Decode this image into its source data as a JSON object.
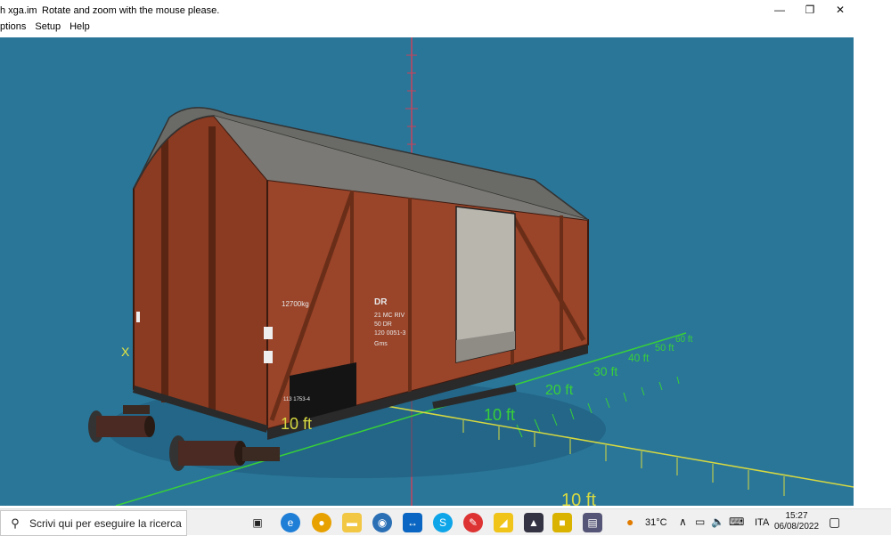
{
  "window": {
    "title": "h xga.im",
    "message": "Rotate and zoom with the mouse please.",
    "controls": {
      "minimize": "—",
      "restore": "❐",
      "close": "✕"
    }
  },
  "menu": [
    {
      "label": "ptions"
    },
    {
      "label": "Setup"
    },
    {
      "label": "Help"
    }
  ],
  "viewport": {
    "background": "#2a7699",
    "axis_label_x": "X",
    "grid_labels_right": [
      "10 ft",
      "20 ft",
      "30 ft",
      "40 ft",
      "50 ft",
      "60 ft"
    ],
    "grid_label_left": "10 ft",
    "grid_label_bottom": "10 ft",
    "wagon_markings": {
      "company": "DR",
      "line1": "21 MC RIV",
      "line2": "50 DR",
      "line3": "120 0051-3",
      "line4": "Gms",
      "weight": "12700kg",
      "bottom": "113 1753-4"
    }
  },
  "taskbar": {
    "search_placeholder": "Scrivi qui per eseguire la ricerca",
    "weather": "31°C",
    "language": "ITA",
    "time": "15:27",
    "date": "06/08/2022",
    "colors": {
      "edge": "#1f7ed6",
      "chrome": "#e7a100",
      "explorer": "#f2c744",
      "skype": "#0ea5e9"
    }
  }
}
